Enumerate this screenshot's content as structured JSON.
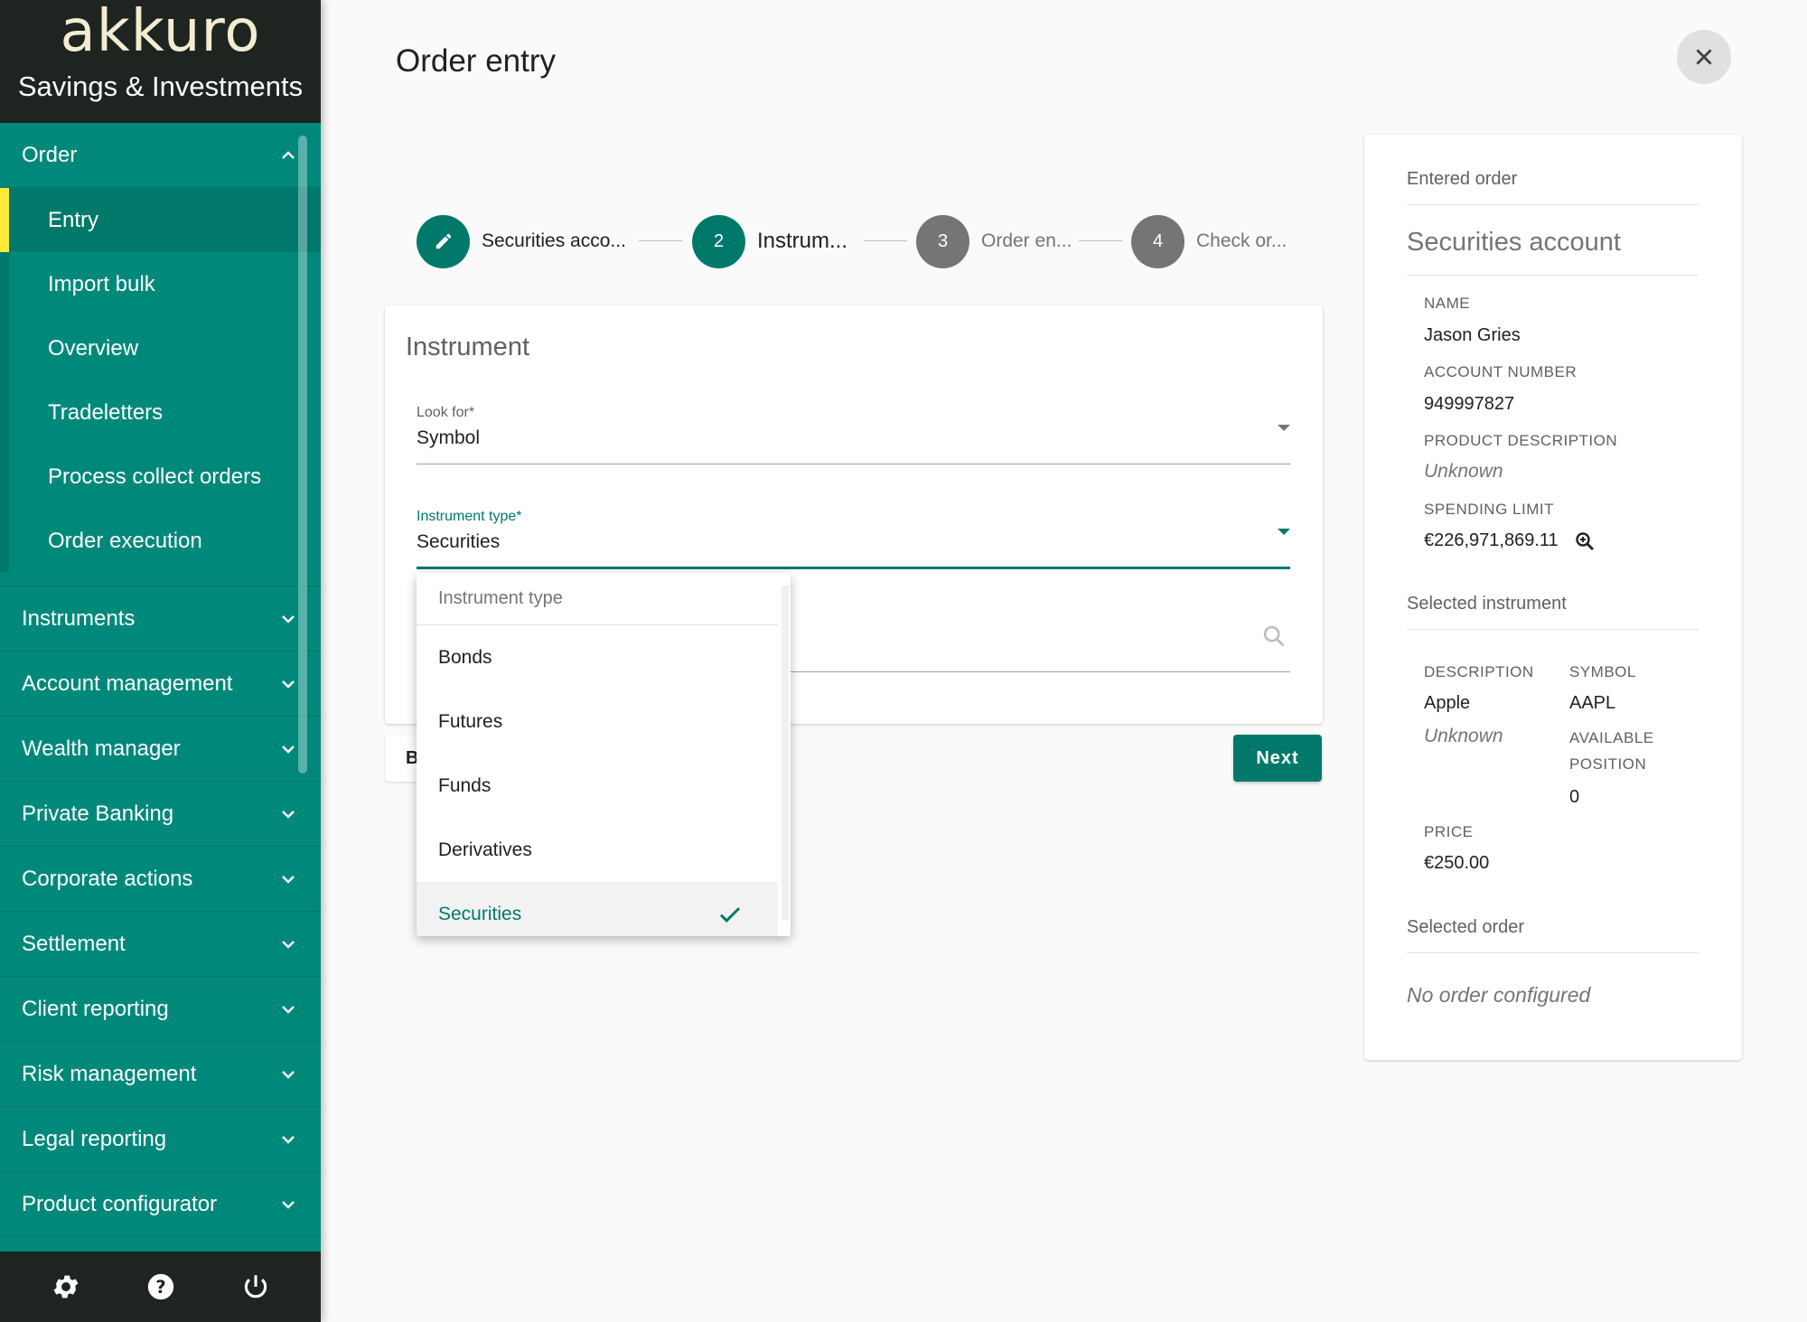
{
  "brand": {
    "logo": "akkuro",
    "subtitle": "Savings & Investments"
  },
  "sidebar": {
    "order_group": {
      "label": "Order",
      "items": [
        "Entry",
        "Import bulk",
        "Overview",
        "Tradeletters",
        "Process collect orders",
        "Order execution"
      ],
      "active": "Entry"
    },
    "groups": [
      "Instruments",
      "Account management",
      "Wealth manager",
      "Private Banking",
      "Corporate actions",
      "Settlement",
      "Client reporting",
      "Risk management",
      "Legal reporting",
      "Product configurator"
    ],
    "footer_icons": [
      "gear-icon",
      "help-icon",
      "power-icon"
    ]
  },
  "page": {
    "title": "Order entry"
  },
  "stepper": [
    {
      "number": "",
      "icon": "pencil-icon",
      "label": "Securities acco...",
      "state": "done"
    },
    {
      "number": "2",
      "label": "Instrum...",
      "state": "active"
    },
    {
      "number": "3",
      "label": "Order en...",
      "state": "pending"
    },
    {
      "number": "4",
      "label": "Check or...",
      "state": "pending"
    }
  ],
  "instrument_card": {
    "title": "Instrument",
    "look_for": {
      "label": "Look for*",
      "value": "Symbol"
    },
    "instrument_type": {
      "label": "Instrument type*",
      "value": "Securities"
    }
  },
  "buttons": {
    "back_label": "B",
    "next_label": "Next"
  },
  "dropdown": {
    "header": "Instrument type",
    "options": [
      "Bonds",
      "Futures",
      "Funds",
      "Derivatives",
      "Securities"
    ],
    "selected": "Securities"
  },
  "summary": {
    "entered_order": "Entered order",
    "securities_account_heading": "Securities account",
    "name_label": "NAME",
    "name_value": "Jason Gries",
    "account_number_label": "ACCOUNT NUMBER",
    "account_number_value": "949997827",
    "product_description_label": "PRODUCT DESCRIPTION",
    "product_description_value": "Unknown",
    "spending_limit_label": "SPENDING LIMIT",
    "spending_limit_value": "€226,971,869.11",
    "selected_instrument": "Selected instrument",
    "description_label": "DESCRIPTION",
    "description_value": "Apple",
    "description_sub": "Unknown",
    "symbol_label": "SYMBOL",
    "symbol_value": "AAPL",
    "available_position_label": "AVAILABLE POSITION",
    "available_position_value": "0",
    "price_label": "PRICE",
    "price_value": "€250.00",
    "selected_order": "Selected order",
    "no_order": "No order configured"
  },
  "colors": {
    "primary": "#00897b",
    "primary_dark": "#00796b",
    "brand_bg": "#1e2420",
    "active_marker": "#ffeb3b",
    "pending_step": "#757575"
  }
}
